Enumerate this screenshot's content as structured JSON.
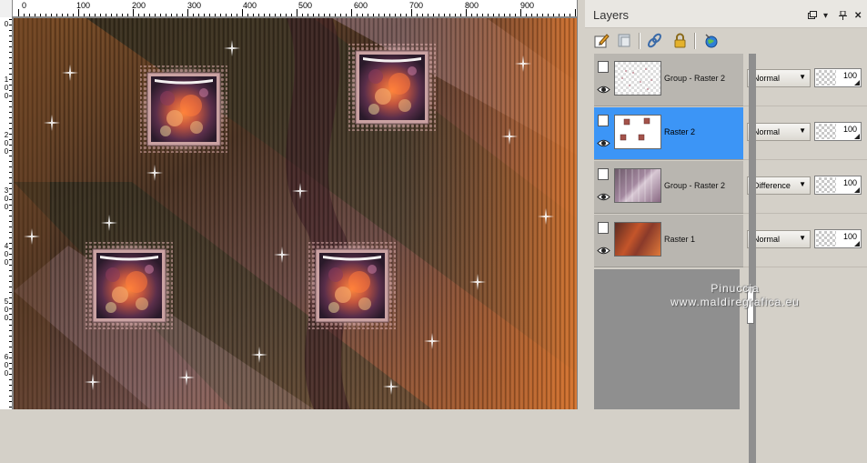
{
  "ruler": {
    "top_labels": [
      "0",
      "100",
      "200",
      "300",
      "400",
      "500",
      "600",
      "700",
      "800",
      "900"
    ],
    "left_labels": [
      [
        "0"
      ],
      [
        "1",
        "0",
        "0"
      ],
      [
        "2",
        "0",
        "0"
      ],
      [
        "3",
        "0",
        "0"
      ],
      [
        "4",
        "0",
        "0"
      ],
      [
        "5",
        "0",
        "0"
      ],
      [
        "6",
        "0",
        "0"
      ]
    ]
  },
  "layers_panel": {
    "title": "Layers",
    "header_buttons": [
      "float-icon",
      "menu-arrow-icon",
      "pin-icon",
      "close-icon"
    ],
    "toolbar_icons": [
      "edit-layer-icon",
      "new-raster-icon",
      "link-icon",
      "lock-icon",
      "globe-icon"
    ],
    "layers": [
      {
        "name": "Group - Raster 2",
        "blend_mode": "Normal",
        "opacity": "100",
        "selected": false,
        "thumb": "group-dots"
      },
      {
        "name": "Raster 2",
        "blend_mode": "Normal",
        "opacity": "100",
        "selected": true,
        "thumb": "frames"
      },
      {
        "name": "Group - Raster 2",
        "blend_mode": "Difference",
        "opacity": "100",
        "selected": false,
        "thumb": "pattern"
      },
      {
        "name": "Raster 1",
        "blend_mode": "Normal",
        "opacity": "100",
        "selected": false,
        "thumb": "background"
      }
    ]
  },
  "watermark": {
    "line1": "Pinuccia",
    "line2": "www.maldiregrafica.eu"
  }
}
